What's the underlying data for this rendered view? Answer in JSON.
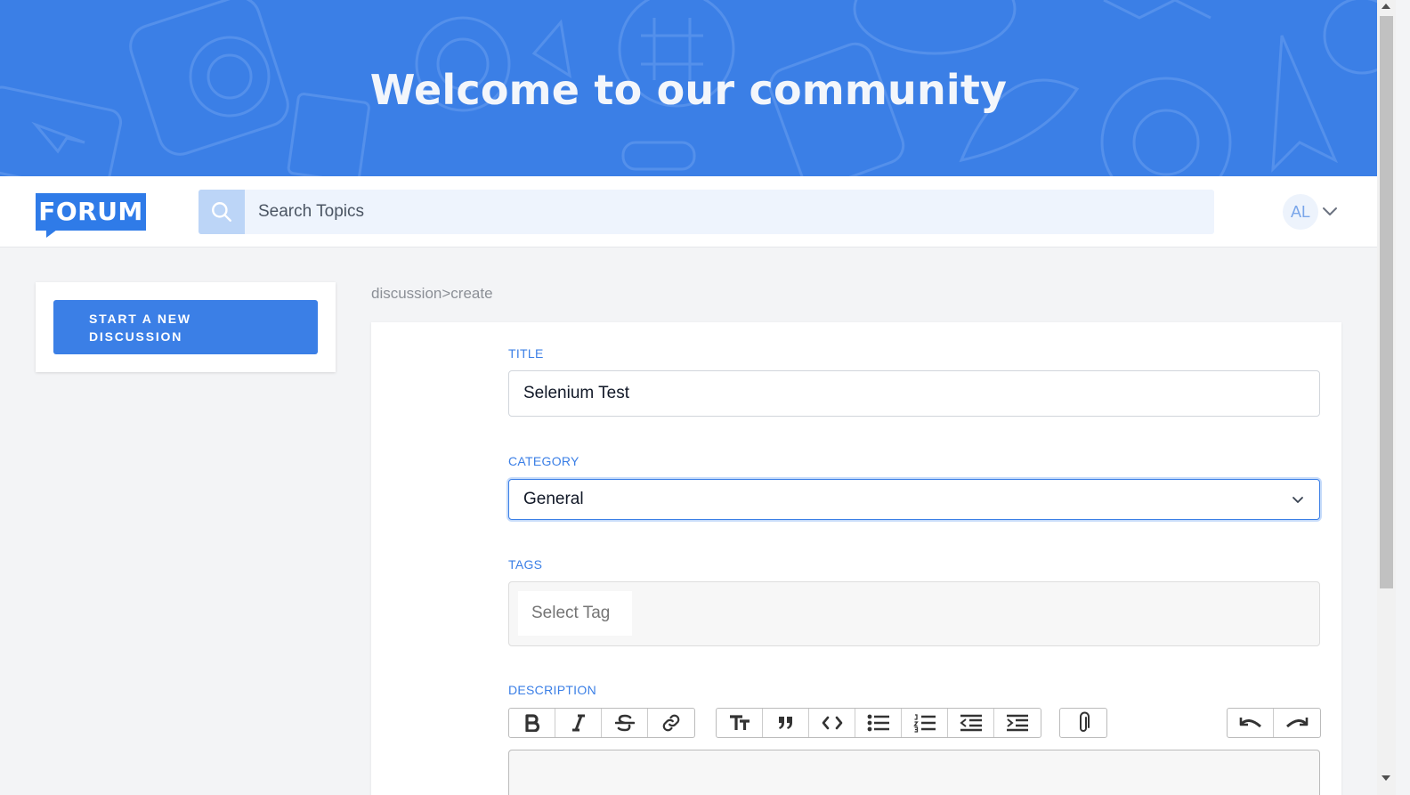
{
  "hero": {
    "title": "Welcome to our community"
  },
  "header": {
    "logo_text": "FORUM",
    "search": {
      "placeholder": "Search Topics",
      "value": ""
    },
    "user": {
      "initials": "AL"
    }
  },
  "sidebar": {
    "new_discussion_label": "START A NEW DISCUSSION"
  },
  "breadcrumb": {
    "path": "discussion>create"
  },
  "form": {
    "title_label": "TITLE",
    "title_value": "Selenium Test",
    "category_label": "CATEGORY",
    "category_value": "General",
    "tags_label": "TAGS",
    "tags_placeholder": "Select Tag",
    "description_label": "DESCRIPTION"
  },
  "toolbar": {
    "groups": [
      [
        "bold-icon",
        "italic-icon",
        "strikethrough-icon",
        "link-icon"
      ],
      [
        "heading-icon",
        "quote-icon",
        "code-icon",
        "bullet-list-icon",
        "numbered-list-icon",
        "outdent-icon",
        "indent-icon"
      ],
      [
        "attach-icon"
      ],
      [
        "undo-icon",
        "redo-icon"
      ]
    ]
  },
  "colors": {
    "brand": "#3b7fe6",
    "hero_bg": "#3b7fe6",
    "page_bg": "#f3f4f6",
    "label": "#3b7fe6"
  }
}
